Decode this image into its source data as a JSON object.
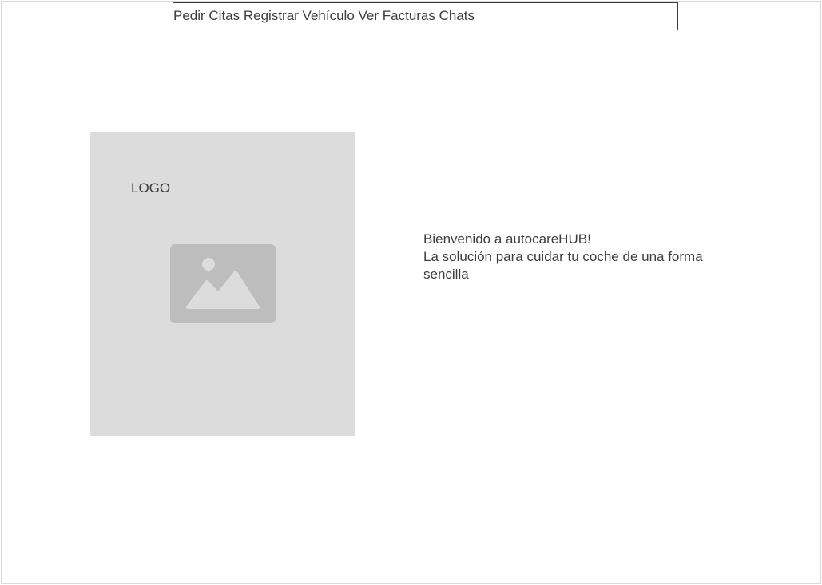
{
  "nav": {
    "items": [
      {
        "label": "Pedir Citas"
      },
      {
        "label": "Registrar Vehículo"
      },
      {
        "label": "Ver Facturas"
      },
      {
        "label": "Chats"
      }
    ]
  },
  "hero": {
    "logo_label": "LOGO",
    "image_icon": "image-placeholder-icon"
  },
  "welcome": {
    "line1": "Bienvenido a autocareHUB!",
    "line2": "La solución para cuidar tu coche de una forma sencilla"
  },
  "colors": {
    "text": "#3d3d3d",
    "placeholder_bg": "#dcdcdc",
    "placeholder_icon": "#bdbdbd",
    "border": "#3d3d3d"
  }
}
